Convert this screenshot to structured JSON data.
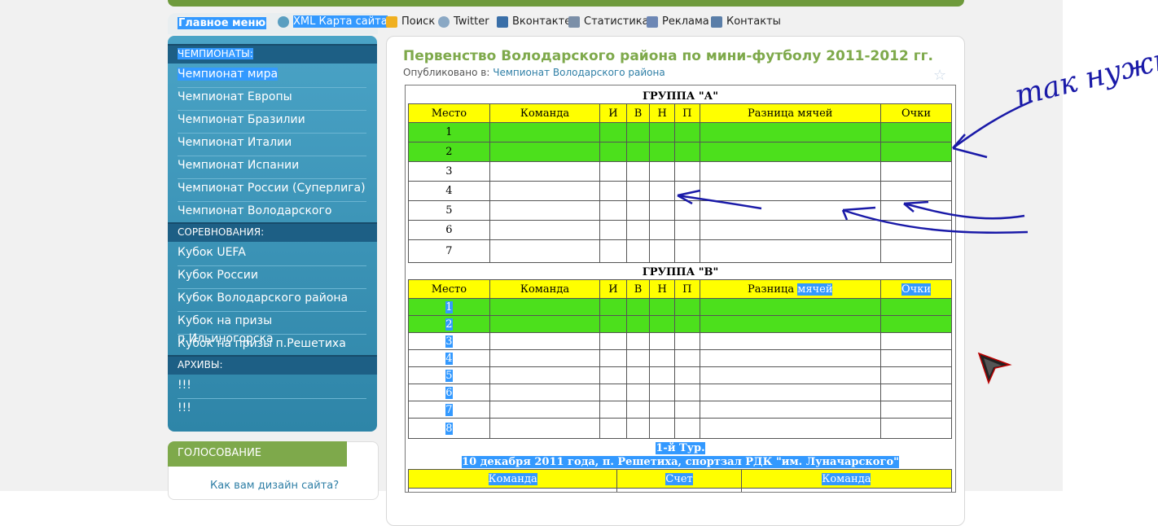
{
  "nav": {
    "menu_title": "Главное меню",
    "links": [
      {
        "label": "XML Карта сайта",
        "icon": "sitemap-icon",
        "selected": true
      },
      {
        "label": "Поиск",
        "icon": "search-icon"
      },
      {
        "label": "Twitter",
        "icon": "twitter-icon"
      },
      {
        "label": "Вконтакте",
        "icon": "vkontakte-icon"
      },
      {
        "label": "Статистика",
        "icon": "statistics-icon"
      },
      {
        "label": "Реклама",
        "icon": "ads-icon"
      },
      {
        "label": "Контакты",
        "icon": "contacts-icon"
      }
    ]
  },
  "sidebar": {
    "sections": [
      {
        "title": "ЧЕМПИОНАТЫ:",
        "items": [
          "Чемпионат мира",
          "Чемпионат Европы",
          "Чемпионат Бразилии",
          "Чемпионат Италии",
          "Чемпионат Испании",
          "Чемпионат России (Суперлига)",
          "Чемпионат Володарского района"
        ]
      },
      {
        "title": "СОРЕВНОВАНИЯ:",
        "items": [
          "Кубок UEFA",
          "Кубок России",
          "Кубок Володарского района",
          "Кубок на призы п.Ильиногорска",
          "Кубок на призы п.Решетиха"
        ]
      },
      {
        "title": "АРХИВЫ:",
        "items": [
          "!!!",
          "!!!"
        ]
      }
    ],
    "vote_title": "ГОЛОСОВАНИЕ",
    "vote_question": "Как вам дизайн сайта?"
  },
  "article": {
    "title": "Первенство Володарского района по мини-футболу 2011-2012 гг.",
    "published_label": "Опубликовано в:",
    "category": "Чемпионат Володарского района"
  },
  "tables": {
    "headers": [
      "Место",
      "Команда",
      "И",
      "В",
      "Н",
      "П",
      "Разница мячей",
      "Очки"
    ],
    "group_a": {
      "title": "ГРУППА \"А\"",
      "places": [
        "1",
        "2",
        "3",
        "4",
        "5",
        "6",
        "7"
      ]
    },
    "group_b": {
      "title": "ГРУППА \"В\"",
      "places": [
        "1",
        "2",
        "3",
        "4",
        "5",
        "6",
        "7",
        "8"
      ]
    },
    "tour": {
      "title": "1-й Тур.",
      "subtitle": "10 декабря 2011 года, п. Решетиха, спортзал РДК \"им. Луначарского\""
    },
    "match_headers": [
      "Команда",
      "Счет",
      "Команда"
    ]
  },
  "annotation": {
    "text": "так нужно",
    "color": "#1a1aa8"
  },
  "colors": {
    "yellow": "#ffff00",
    "green": "#4ce01c",
    "title_green": "#7ea94b",
    "sidebar_blue": "#3a93b8"
  }
}
